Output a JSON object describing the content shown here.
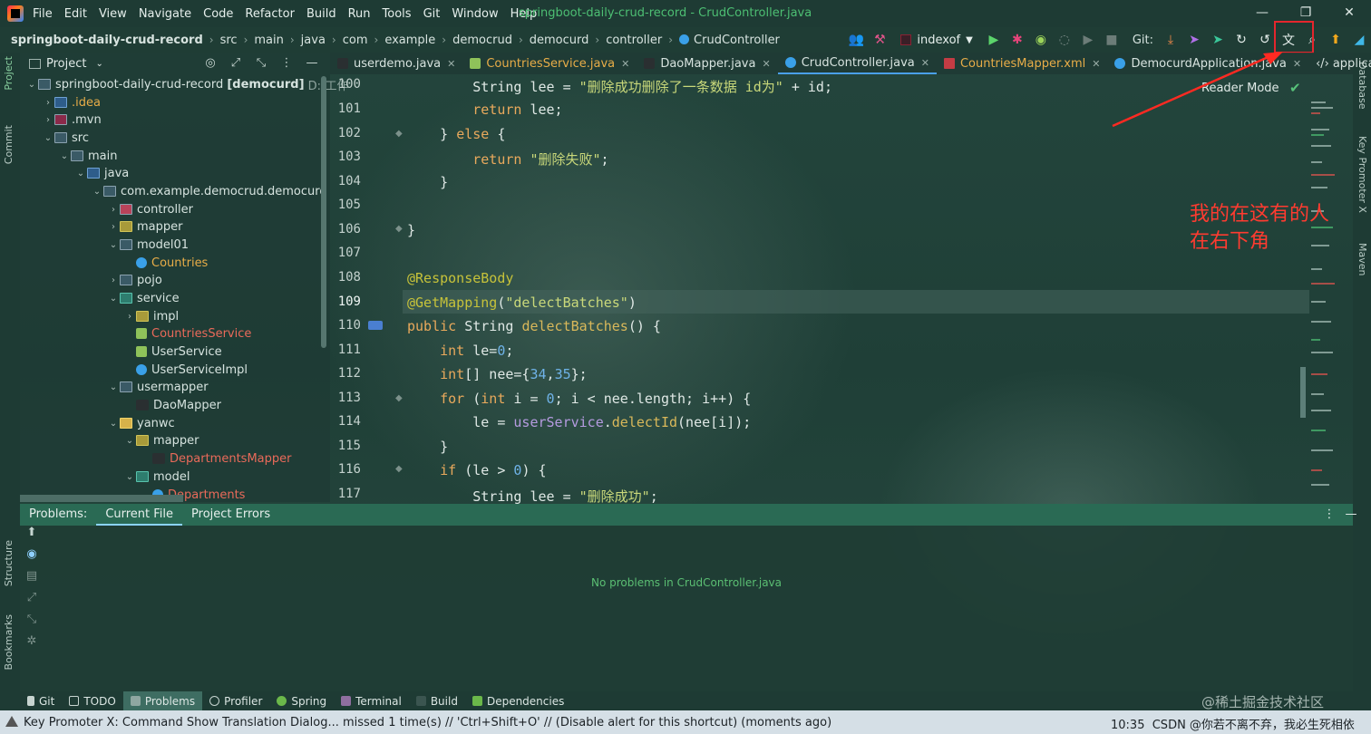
{
  "menu": [
    "File",
    "Edit",
    "View",
    "Navigate",
    "Code",
    "Refactor",
    "Build",
    "Run",
    "Tools",
    "Git",
    "Window",
    "Help"
  ],
  "window_title": "springboot-daily-crud-record - CrudController.java",
  "breadcrumbs": [
    "springboot-daily-crud-record",
    "src",
    "main",
    "java",
    "com",
    "example",
    "democrud",
    "democurd",
    "controller",
    "CrudController"
  ],
  "navbar": {
    "branch": "indexof",
    "git_label": "Git:"
  },
  "side_tabs_left": [
    "Project",
    "Commit",
    "Structure",
    "Bookmarks"
  ],
  "side_tabs_right": [
    "Database",
    "Key Promoter X",
    "Maven"
  ],
  "project": {
    "title": "Project",
    "root_name": "springboot-daily-crud-record",
    "root_module": "[democurd]",
    "root_path": "D:\\工作",
    "items": [
      {
        "label": ".idea",
        "kind": "folder",
        "style": "orange"
      },
      {
        "label": ".mvn",
        "kind": "folder",
        "style": "plain"
      },
      {
        "label": "src",
        "kind": "folder",
        "style": "plain"
      },
      {
        "label": "main",
        "kind": "folder",
        "style": "plain"
      },
      {
        "label": "java",
        "kind": "folder",
        "style": "plain"
      },
      {
        "label": "com.example.democrud.democurd",
        "kind": "package",
        "style": "plain"
      },
      {
        "label": "controller",
        "kind": "package",
        "style": "plain"
      },
      {
        "label": "mapper",
        "kind": "package",
        "style": "plain"
      },
      {
        "label": "model01",
        "kind": "package",
        "style": "plain"
      },
      {
        "label": "Countries",
        "kind": "class",
        "style": "orange"
      },
      {
        "label": "pojo",
        "kind": "package",
        "style": "plain"
      },
      {
        "label": "service",
        "kind": "package",
        "style": "plain"
      },
      {
        "label": "impl",
        "kind": "package",
        "style": "plain"
      },
      {
        "label": "CountriesService",
        "kind": "interface",
        "style": "red"
      },
      {
        "label": "UserService",
        "kind": "interface",
        "style": "plain"
      },
      {
        "label": "UserServiceImpl",
        "kind": "class",
        "style": "plain"
      },
      {
        "label": "usermapper",
        "kind": "package",
        "style": "plain"
      },
      {
        "label": "DaoMapper",
        "kind": "mapper",
        "style": "plain"
      },
      {
        "label": "yanwc",
        "kind": "package",
        "style": "plain"
      },
      {
        "label": "mapper",
        "kind": "package",
        "style": "plain"
      },
      {
        "label": "DepartmentsMapper",
        "kind": "mapper",
        "style": "red"
      },
      {
        "label": "model",
        "kind": "package",
        "style": "plain"
      },
      {
        "label": "Departments",
        "kind": "class",
        "style": "red"
      }
    ]
  },
  "editor_tabs": [
    {
      "label": "userdemo.java",
      "active": false,
      "style": "plain"
    },
    {
      "label": "CountriesService.java",
      "active": false,
      "style": "orange"
    },
    {
      "label": "DaoMapper.java",
      "active": false,
      "style": "plain"
    },
    {
      "label": "CrudController.java",
      "active": true,
      "style": "plain"
    },
    {
      "label": "CountriesMapper.xml",
      "active": false,
      "style": "orange"
    },
    {
      "label": "DemocurdApplication.java",
      "active": false,
      "style": "plain"
    },
    {
      "label": "applicatio",
      "active": false,
      "style": "plain"
    }
  ],
  "reader_mode": "Reader Mode",
  "line_numbers": [
    "100",
    "101",
    "102",
    "103",
    "104",
    "105",
    "106",
    "107",
    "108",
    "109",
    "110",
    "111",
    "112",
    "113",
    "114",
    "115",
    "116",
    "117"
  ],
  "current_line": "109",
  "code_lines": [
    "        String lee = \"删除成功删除了一条数据 id为\" + id;",
    "        return lee;",
    "    } else {",
    "        return \"删除失败\";",
    "    }",
    "",
    "}",
    "",
    "@ResponseBody",
    "@GetMapping(\"delectBatches\")",
    "public String delectBatches() {",
    "    int le=0;",
    "    int[] nee={34,35};",
    "    for (int i = 0; i < nee.length; i++) {",
    "        le = userService.delectId(nee[i]);",
    "    }",
    "    if (le > 0) {",
    "        String lee = \"删除成功\";"
  ],
  "annotation_note": [
    "我的在这有的人",
    "在右下角"
  ],
  "problems": {
    "label": "Problems:",
    "tabs": [
      "Current File",
      "Project Errors"
    ],
    "message": "No problems in CrudController.java"
  },
  "bottom_tools": [
    "Git",
    "TODO",
    "Problems",
    "Profiler",
    "Spring",
    "Terminal",
    "Build",
    "Dependencies"
  ],
  "bottom_active": "Problems",
  "status": {
    "message": "Key Promoter X: Command Show Translation Dialog... missed 1 time(s) // 'Ctrl+Shift+O' // (Disable alert for this shortcut) (moments ago)",
    "right": "10:35",
    "watermark": "@稀土掘金技术社区",
    "watermark2": "CSDN @你若不离不弃，我必生死相依"
  },
  "colors": {
    "annotation": "#ff3b30",
    "accent": "#4aa0e8",
    "success": "#4dbf73"
  }
}
